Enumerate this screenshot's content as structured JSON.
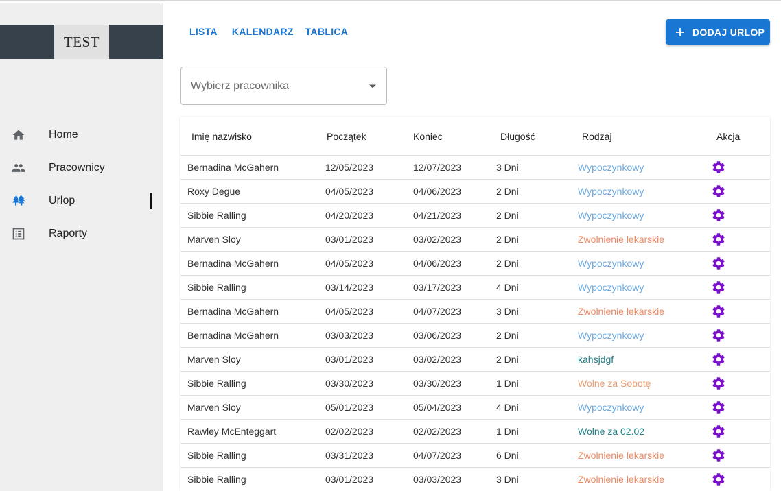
{
  "app": {
    "logo_text": "TEST"
  },
  "sidebar": {
    "items": [
      {
        "label": "Home",
        "icon": "home-icon"
      },
      {
        "label": "Pracownicy",
        "icon": "people-icon"
      },
      {
        "label": "Urlop",
        "icon": "trees-icon",
        "active": true
      },
      {
        "label": "Raporty",
        "icon": "list-report-icon"
      }
    ]
  },
  "tabs": [
    {
      "label": "LISTA"
    },
    {
      "label": "KALENDARZ"
    },
    {
      "label": "TABLICA"
    }
  ],
  "add_button": {
    "label": "DODAJ URLOP",
    "icon": "plus-icon"
  },
  "employee_select": {
    "placeholder": "Wybierz pracownika",
    "icon": "caret-down-icon"
  },
  "colors": {
    "accent": "#1976d2",
    "sidebar_bg": "#efefef",
    "logo_band": "#36414b",
    "gear": "#7b12c9",
    "type_wypoczynkowy": "#6aa8e0",
    "type_zwolnienie": "#ef8a62",
    "type_wolne": "#ec9a6c",
    "type_custom": "#1f7f86",
    "trees_icon": "#1976d2"
  },
  "table": {
    "headers": [
      "Imię nazwisko",
      "Początek",
      "Koniec",
      "Długość",
      "Rodzaj",
      "Akcja"
    ],
    "rows": [
      {
        "name": "Bernadina McGahern",
        "start": "12/05/2023",
        "end": "12/07/2023",
        "length": "3 Dni",
        "type": "Wypoczynkowy",
        "type_color": "#6aa8e0"
      },
      {
        "name": "Roxy Degue",
        "start": "04/05/2023",
        "end": "04/06/2023",
        "length": "2 Dni",
        "type": "Wypoczynkowy",
        "type_color": "#6aa8e0"
      },
      {
        "name": "Sibbie Ralling",
        "start": "04/20/2023",
        "end": "04/21/2023",
        "length": "2 Dni",
        "type": "Wypoczynkowy",
        "type_color": "#6aa8e0"
      },
      {
        "name": "Marven Sloy",
        "start": "03/01/2023",
        "end": "03/02/2023",
        "length": "2 Dni",
        "type": "Zwolnienie lekarskie",
        "type_color": "#ef8a62"
      },
      {
        "name": "Bernadina McGahern",
        "start": "04/05/2023",
        "end": "04/06/2023",
        "length": "2 Dni",
        "type": "Wypoczynkowy",
        "type_color": "#6aa8e0"
      },
      {
        "name": "Sibbie Ralling",
        "start": "03/14/2023",
        "end": "03/17/2023",
        "length": "4 Dni",
        "type": "Wypoczynkowy",
        "type_color": "#6aa8e0"
      },
      {
        "name": "Bernadina McGahern",
        "start": "04/05/2023",
        "end": "04/07/2023",
        "length": "3 Dni",
        "type": "Zwolnienie lekarskie",
        "type_color": "#ef8a62"
      },
      {
        "name": "Bernadina McGahern",
        "start": "03/03/2023",
        "end": "03/06/2023",
        "length": "2 Dni",
        "type": "Wypoczynkowy",
        "type_color": "#6aa8e0"
      },
      {
        "name": "Marven Sloy",
        "start": "03/01/2023",
        "end": "03/02/2023",
        "length": "2 Dni",
        "type": "kahsjdgf",
        "type_color": "#1f7f86"
      },
      {
        "name": "Sibbie Ralling",
        "start": "03/30/2023",
        "end": "03/30/2023",
        "length": "1 Dni",
        "type": "Wolne za Sobotę",
        "type_color": "#ec9a6c"
      },
      {
        "name": "Marven Sloy",
        "start": "05/01/2023",
        "end": "05/04/2023",
        "length": "4 Dni",
        "type": "Wypoczynkowy",
        "type_color": "#6aa8e0"
      },
      {
        "name": "Rawley McEnteggart",
        "start": "02/02/2023",
        "end": "02/02/2023",
        "length": "1 Dni",
        "type": "Wolne za 02.02",
        "type_color": "#1f7f86"
      },
      {
        "name": "Sibbie Ralling",
        "start": "03/31/2023",
        "end": "04/07/2023",
        "length": "6 Dni",
        "type": "Zwolnienie lekarskie",
        "type_color": "#ef8a62"
      },
      {
        "name": "Sibbie Ralling",
        "start": "03/01/2023",
        "end": "03/03/2023",
        "length": "3 Dni",
        "type": "Zwolnienie lekarskie",
        "type_color": "#ef8a62"
      }
    ]
  }
}
